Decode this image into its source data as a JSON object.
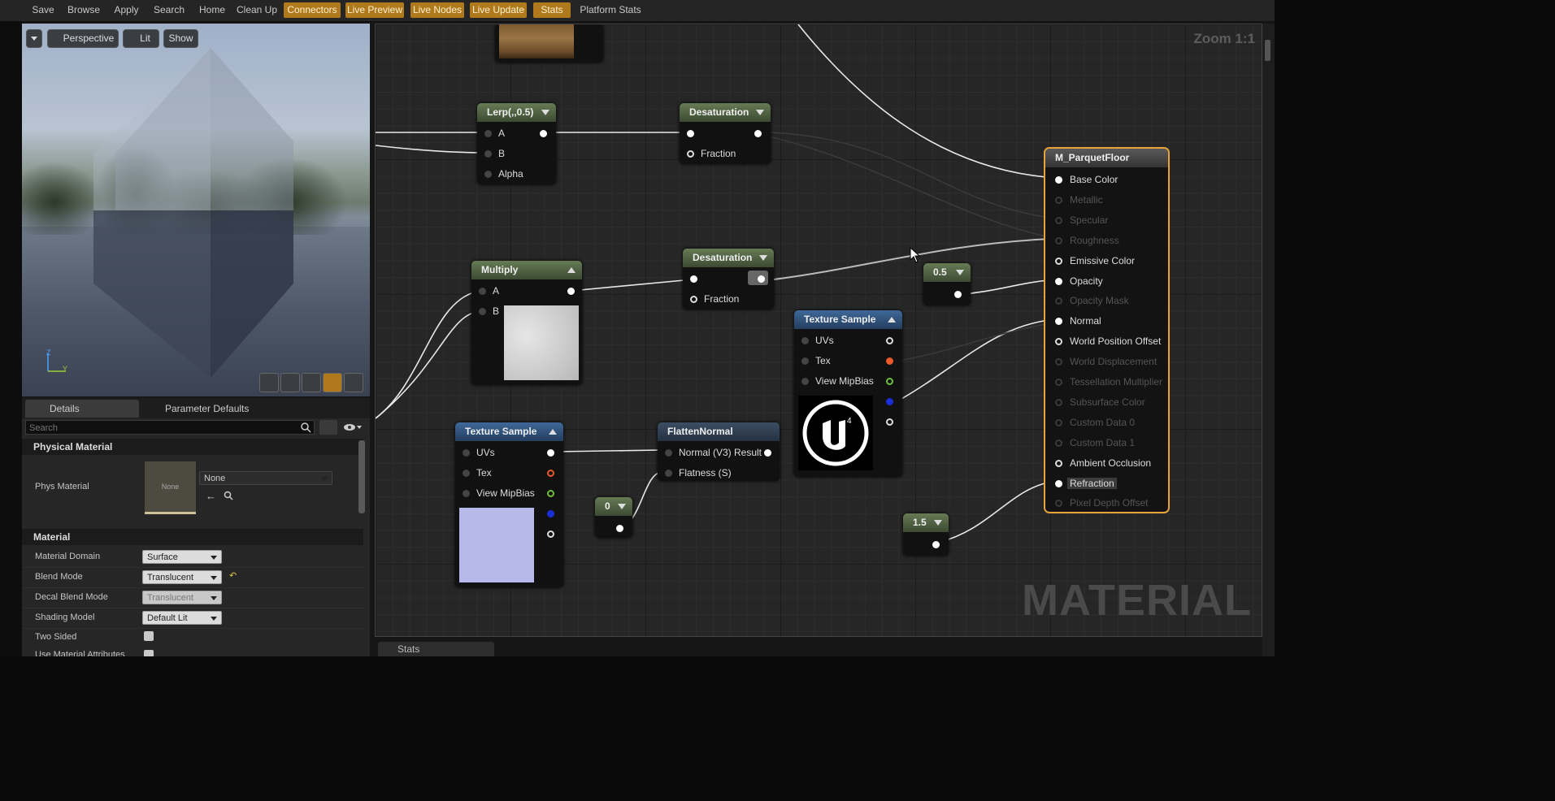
{
  "toolbar": {
    "items": [
      {
        "label": "Save",
        "active": false
      },
      {
        "label": "Browse",
        "active": false
      },
      {
        "label": "Apply",
        "active": false
      },
      {
        "label": "Search",
        "active": false
      },
      {
        "label": "Home",
        "active": false
      },
      {
        "label": "Clean Up",
        "active": false
      },
      {
        "label": "Connectors",
        "active": true
      },
      {
        "label": "Live Preview",
        "active": true
      },
      {
        "label": "Live Nodes",
        "active": true
      },
      {
        "label": "Live Update",
        "active": true
      },
      {
        "label": "Stats",
        "active": true
      },
      {
        "label": "Platform Stats",
        "active": false
      }
    ]
  },
  "viewport": {
    "perspective_label": "Perspective",
    "lit_label": "Lit",
    "show_label": "Show",
    "axis_z": "Z",
    "axis_y": "Y"
  },
  "details": {
    "tab_details": "Details",
    "tab_params": "Parameter Defaults",
    "search_placeholder": "Search",
    "physical_material_section": "Physical Material",
    "phys_material_label": "Phys Material",
    "phys_thumb_label": "None",
    "phys_value": "None",
    "material_section": "Material",
    "props": [
      {
        "label": "Material Domain",
        "value": "Surface",
        "disabled": false
      },
      {
        "label": "Blend Mode",
        "value": "Translucent",
        "disabled": false
      },
      {
        "label": "Decal Blend Mode",
        "value": "Translucent",
        "disabled": true
      },
      {
        "label": "Shading Model",
        "value": "Default Lit",
        "disabled": false
      }
    ],
    "two_sided_label": "Two Sided",
    "use_attr_label": "Use Material Attributes"
  },
  "graph": {
    "zoom": "Zoom 1:1",
    "watermark": "MATERIAL",
    "lerp": {
      "title": "Lerp(,,0.5)",
      "pins": [
        "A",
        "B",
        "Alpha"
      ]
    },
    "desat1": {
      "title": "Desaturation",
      "pin_fraction": "Fraction"
    },
    "desat2": {
      "title": "Desaturation",
      "pin_fraction": "Fraction"
    },
    "multiply": {
      "title": "Multiply",
      "pins": [
        "A",
        "B"
      ]
    },
    "tex1": {
      "title": "Texture Sample",
      "pins": [
        "UVs",
        "Tex",
        "View MipBias"
      ]
    },
    "tex2": {
      "title": "Texture Sample",
      "pins": [
        "UVs",
        "Tex",
        "View MipBias"
      ]
    },
    "flatten": {
      "title": "FlattenNormal",
      "pin_normal": "Normal (V3)",
      "pin_result": "Result",
      "pin_flatness": "Flatness (S)"
    },
    "const_05": "0.5",
    "const_0": "0",
    "const_15": "1.5",
    "result": {
      "title": "M_ParquetFloor",
      "pins": [
        {
          "label": "Base Color",
          "enabled": true
        },
        {
          "label": "Metallic",
          "enabled": false
        },
        {
          "label": "Specular",
          "enabled": false
        },
        {
          "label": "Roughness",
          "enabled": false
        },
        {
          "label": "Emissive Color",
          "enabled": true
        },
        {
          "label": "Opacity",
          "enabled": true
        },
        {
          "label": "Opacity Mask",
          "enabled": false
        },
        {
          "label": "Normal",
          "enabled": true
        },
        {
          "label": "World Position Offset",
          "enabled": true
        },
        {
          "label": "World Displacement",
          "enabled": false
        },
        {
          "label": "Tessellation Multiplier",
          "enabled": false
        },
        {
          "label": "Subsurface Color",
          "enabled": false
        },
        {
          "label": "Custom Data 0",
          "enabled": false
        },
        {
          "label": "Custom Data 1",
          "enabled": false
        },
        {
          "label": "Ambient Occlusion",
          "enabled": true
        },
        {
          "label": "Refraction",
          "enabled": true
        },
        {
          "label": "Pixel Depth Offset",
          "enabled": false
        }
      ]
    }
  },
  "bottom": {
    "stats_tab": "Stats"
  }
}
